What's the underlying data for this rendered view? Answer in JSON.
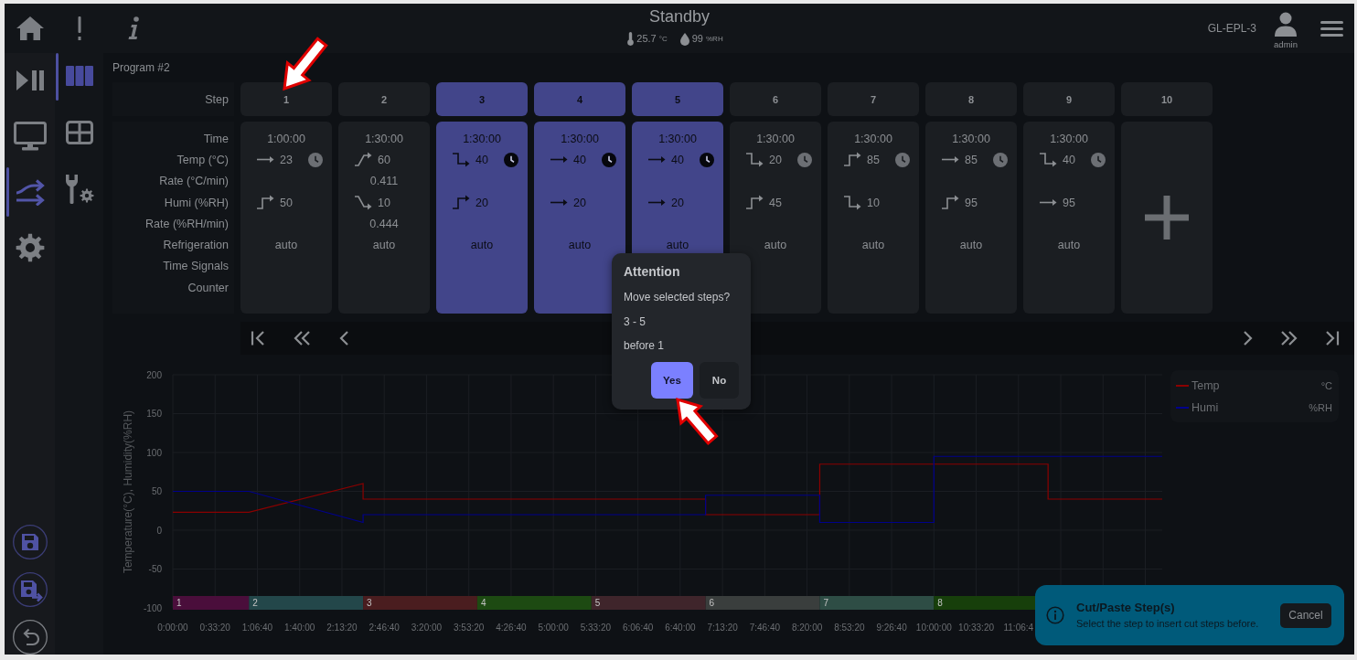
{
  "top_bar": {
    "status": "Standby",
    "temperature": {
      "value": "25.7",
      "unit": "°C"
    },
    "humidity": {
      "value": "99",
      "unit": "%RH"
    },
    "device": "GL-EPL-3",
    "user": "admin"
  },
  "nav_rail": {
    "items": [
      {
        "kind": "run",
        "selected": false
      },
      {
        "kind": "monitor",
        "selected": false
      },
      {
        "kind": "program",
        "selected": true
      },
      {
        "kind": "settings",
        "selected": false
      }
    ]
  },
  "sub_rail": {
    "items": [
      {
        "kind": "steps",
        "selected": true
      },
      {
        "kind": "table",
        "selected": false
      },
      {
        "kind": "tools",
        "selected": false
      }
    ]
  },
  "program": {
    "title": "Program #2",
    "header_label": "Step",
    "row_labels": [
      "Time",
      "Temp (°C)",
      "Rate (°C/min)",
      "Humi (%RH)",
      "Rate (%RH/min)",
      "Refrigeration",
      "Time Signals",
      "Counter"
    ],
    "steps": [
      {
        "label": "1",
        "selected": false,
        "time": "1:00:00",
        "temp": {
          "kind": "hold",
          "value": "23",
          "wait": true
        },
        "humi": {
          "kind": "jump-up",
          "value": "50"
        },
        "refrigeration": "auto"
      },
      {
        "label": "2",
        "selected": false,
        "time": "1:30:00",
        "temp": {
          "kind": "ramp-up",
          "value": "60",
          "wait": false,
          "rate": "0.411"
        },
        "humi": {
          "kind": "ramp-down",
          "value": "10",
          "rate": "0.444"
        },
        "refrigeration": "auto"
      },
      {
        "label": "3",
        "selected": true,
        "time": "1:30:00",
        "temp": {
          "kind": "jump-down",
          "value": "40",
          "wait": true
        },
        "humi": {
          "kind": "jump-up",
          "value": "20"
        },
        "refrigeration": "auto"
      },
      {
        "label": "4",
        "selected": true,
        "time": "1:30:00",
        "temp": {
          "kind": "hold",
          "value": "40",
          "wait": true
        },
        "humi": {
          "kind": "hold",
          "value": "20"
        },
        "refrigeration": "auto"
      },
      {
        "label": "5",
        "selected": true,
        "time": "1:30:00",
        "temp": {
          "kind": "hold",
          "value": "40",
          "wait": true
        },
        "humi": {
          "kind": "hold",
          "value": "20"
        },
        "refrigeration": "auto"
      },
      {
        "label": "6",
        "selected": false,
        "time": "1:30:00",
        "temp": {
          "kind": "jump-down",
          "value": "20",
          "wait": true
        },
        "humi": {
          "kind": "jump-up",
          "value": "45"
        },
        "refrigeration": "auto"
      },
      {
        "label": "7",
        "selected": false,
        "time": "1:30:00",
        "temp": {
          "kind": "jump-up",
          "value": "85",
          "wait": true
        },
        "humi": {
          "kind": "jump-down",
          "value": "10"
        },
        "refrigeration": "auto"
      },
      {
        "label": "8",
        "selected": false,
        "time": "1:30:00",
        "temp": {
          "kind": "hold",
          "value": "85",
          "wait": true
        },
        "humi": {
          "kind": "jump-up",
          "value": "95"
        },
        "refrigeration": "auto"
      },
      {
        "label": "9",
        "selected": false,
        "time": "1:30:00",
        "temp": {
          "kind": "jump-down",
          "value": "40",
          "wait": true
        },
        "humi": {
          "kind": "hold",
          "value": "95"
        },
        "refrigeration": "auto"
      }
    ],
    "new_step": {
      "label": "10"
    }
  },
  "chart": {
    "chart_data": {
      "type": "line",
      "ylabel": "Temperature(°C), Humidity(%RH)",
      "x": [
        0,
        3600,
        9000,
        9000,
        25200,
        25200,
        30600,
        30600,
        36000,
        36000,
        41400,
        41400,
        46800
      ],
      "series": [
        {
          "name": "Temp",
          "color": "#8b0000",
          "values": [
            23,
            23,
            60,
            40,
            40,
            20,
            20,
            85,
            85,
            85,
            85,
            40,
            40
          ]
        },
        {
          "name": "Humi",
          "color": "#00008b",
          "values": [
            50,
            50,
            10,
            20,
            20,
            45,
            45,
            10,
            10,
            95,
            95,
            95,
            95
          ]
        }
      ],
      "xlim": [
        0,
        46800
      ],
      "ylim": [
        -100,
        200
      ],
      "grid": true,
      "xticks": [
        {
          "value": 0,
          "label": "0:00:00"
        },
        {
          "value": 2000,
          "label": "0:33:20"
        },
        {
          "value": 4000,
          "label": "1:06:40"
        },
        {
          "value": 6000,
          "label": "1:40:00"
        },
        {
          "value": 8000,
          "label": "2:13:20"
        },
        {
          "value": 10000,
          "label": "2:46:40"
        },
        {
          "value": 12000,
          "label": "3:20:00"
        },
        {
          "value": 14000,
          "label": "3:53:20"
        },
        {
          "value": 16000,
          "label": "4:26:40"
        },
        {
          "value": 18000,
          "label": "5:00:00"
        },
        {
          "value": 20000,
          "label": "5:33:20"
        },
        {
          "value": 22000,
          "label": "6:06:40"
        },
        {
          "value": 24000,
          "label": "6:40:00"
        },
        {
          "value": 26000,
          "label": "7:13:20"
        },
        {
          "value": 28000,
          "label": "7:46:40"
        },
        {
          "value": 30000,
          "label": "8:20:00"
        },
        {
          "value": 32000,
          "label": "8:53:20"
        },
        {
          "value": 34000,
          "label": "9:26:40"
        },
        {
          "value": 36000,
          "label": "10:00:00"
        },
        {
          "value": 38000,
          "label": "10:33:20"
        },
        {
          "value": 40000,
          "label": "11:06:4"
        }
      ],
      "yticks": [
        -100,
        -50,
        0,
        50,
        100,
        150,
        200
      ]
    },
    "legend_units": [
      "°C",
      "%RH"
    ],
    "step_bands": [
      {
        "label": "1",
        "color": "#4a0e3b"
      },
      {
        "label": "2",
        "color": "#23474a"
      },
      {
        "label": "3",
        "color": "#4a1d1f"
      },
      {
        "label": "4",
        "color": "#1d4a12"
      },
      {
        "label": "5",
        "color": "#3f252b"
      },
      {
        "label": "6",
        "color": "#3a3e3d"
      },
      {
        "label": "7",
        "color": "#2e4d45"
      },
      {
        "label": "8",
        "color": "#173f0b"
      }
    ]
  },
  "dialog": {
    "title": "Attention",
    "message": "Move selected steps?",
    "range": "3 - 5",
    "position": "before 1",
    "buttons": [
      {
        "label": "Yes",
        "kind": "primary"
      },
      {
        "label": "No",
        "kind": "secondary"
      }
    ]
  },
  "toast": {
    "title": "Cut/Paste Step(s)",
    "message": "Select the step to insert cut steps before.",
    "button": "Cancel"
  }
}
